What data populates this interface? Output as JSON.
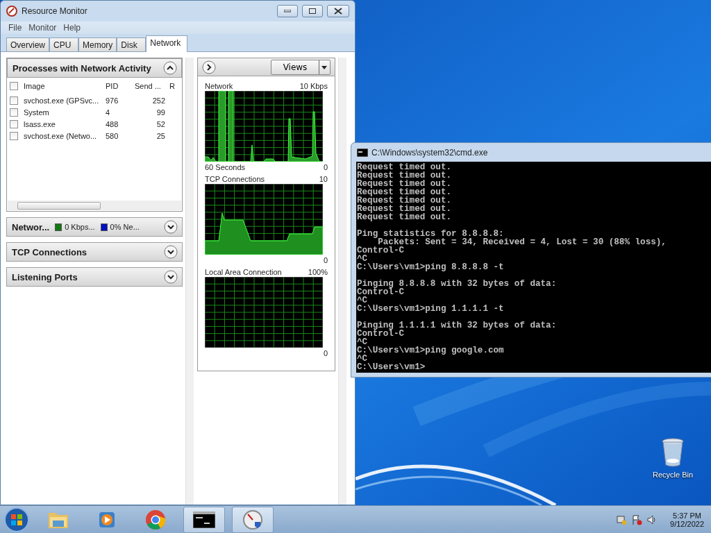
{
  "resource_monitor": {
    "title": "Resource Monitor",
    "menu": [
      "File",
      "Monitor",
      "Help"
    ],
    "tabs": [
      {
        "label": "Overview",
        "selected": false
      },
      {
        "label": "CPU",
        "selected": false
      },
      {
        "label": "Memory",
        "selected": false
      },
      {
        "label": "Disk",
        "selected": false
      },
      {
        "label": "Network",
        "selected": true
      }
    ],
    "processes": {
      "title": "Processes with Network Activity",
      "expanded": true,
      "all_checked": false,
      "columns": [
        "Image",
        "PID",
        "Send ...",
        "R"
      ],
      "rows": [
        {
          "checked": false,
          "image": "svchost.exe (GPSvc...",
          "pid": "976",
          "send": "252"
        },
        {
          "checked": false,
          "image": "System",
          "pid": "4",
          "send": "99"
        },
        {
          "checked": false,
          "image": "lsass.exe",
          "pid": "488",
          "send": "52"
        },
        {
          "checked": false,
          "image": "svchost.exe (Netwo...",
          "pid": "580",
          "send": "25"
        }
      ]
    },
    "sections": [
      {
        "title": "Networ...",
        "expanded": false,
        "legend": [
          {
            "color": "#127812",
            "text": "0 Kbps..."
          },
          {
            "color": "#0010c0",
            "text": "0% Ne..."
          }
        ]
      },
      {
        "title": "TCP Connections",
        "expanded": false
      },
      {
        "title": "Listening Ports",
        "expanded": false
      }
    ],
    "graphs_panel": {
      "views": "Views",
      "graphs": [
        {
          "kind": "spikes",
          "title": "Network",
          "max": "10 Kbps",
          "caption": "60 Seconds",
          "min": "0"
        },
        {
          "kind": "area",
          "title": "TCP Connections",
          "max": "10",
          "min": "0"
        },
        {
          "kind": "empty",
          "title": "Local Area Connection",
          "max": "100%",
          "min": "0"
        }
      ]
    }
  },
  "cmd": {
    "title": "C:\\Windows\\system32\\cmd.exe",
    "paragraphs": [
      [
        "Request timed out.",
        "Request timed out.",
        "Request timed out.",
        "Request timed out.",
        "Request timed out.",
        "Request timed out.",
        "Request timed out."
      ],
      [
        "Ping statistics for 8.8.8.8:",
        "    Packets: Sent = 34, Received = 4, Lost = 30 (88% loss),",
        "Control-C",
        "^C",
        "C:\\Users\\vm1>ping 8.8.8.8 -t"
      ],
      [
        "Pinging 8.8.8.8 with 32 bytes of data:",
        "Control-C",
        "^C",
        "C:\\Users\\vm1>ping 1.1.1.1 -t"
      ],
      [
        "Pinging 1.1.1.1 with 32 bytes of data:",
        "Control-C",
        "^C",
        "C:\\Users\\vm1>ping google.com",
        "^C",
        "C:\\Users\\vm1>"
      ]
    ]
  },
  "desktop_icons": [
    {
      "label": "Recycle Bin"
    }
  ],
  "taskbar": {
    "apps": [
      {
        "kind": "explorer",
        "running": false
      },
      {
        "kind": "media",
        "running": false
      },
      {
        "kind": "chrome",
        "running": false
      },
      {
        "kind": "console",
        "running": true
      },
      {
        "kind": "gauge",
        "running": true
      }
    ],
    "clock": {
      "time": "5:37 PM",
      "date": "9/12/2022"
    }
  }
}
